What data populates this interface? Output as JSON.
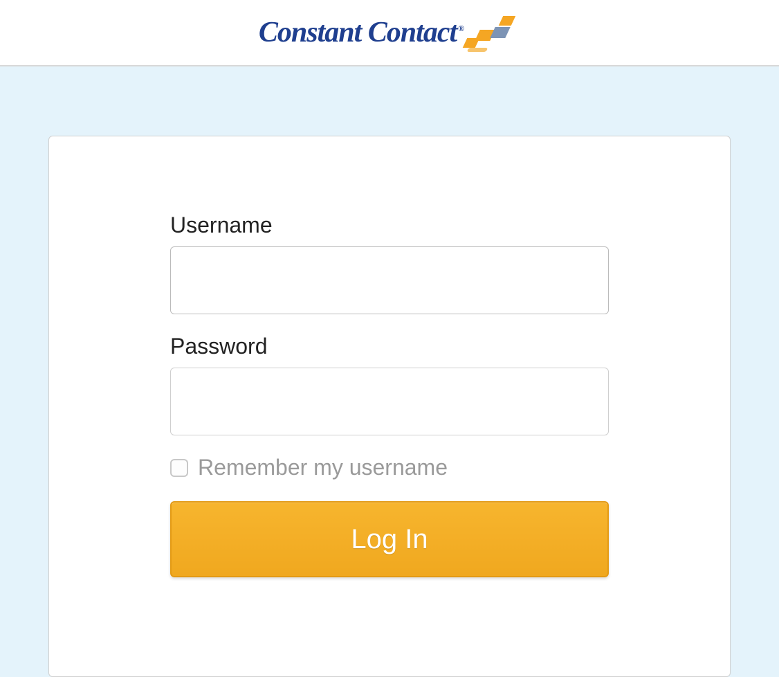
{
  "header": {
    "brand": "Constant Contact",
    "registered": "®"
  },
  "form": {
    "username_label": "Username",
    "username_value": "",
    "password_label": "Password",
    "password_value": "",
    "remember_label": "Remember my username",
    "remember_checked": false,
    "login_button": "Log In"
  }
}
